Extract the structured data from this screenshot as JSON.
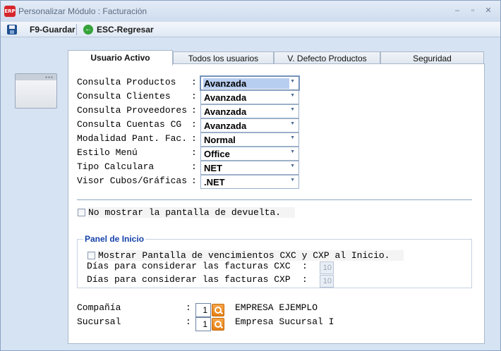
{
  "window": {
    "title": "Personalizar Módulo : Facturación",
    "app_icon_text": "ERP"
  },
  "toolbar": {
    "save_label": "F9-Guardar",
    "back_label": "ESC-Regresar"
  },
  "tabs": [
    {
      "label": "Usuario Activo",
      "active": true
    },
    {
      "label": "Todos los usuarios",
      "active": false
    },
    {
      "label": "V. Defecto Productos",
      "active": false
    },
    {
      "label": "Seguridad",
      "active": false
    }
  ],
  "settings": [
    {
      "label": "Consulta Productos",
      "value": "Avanzada"
    },
    {
      "label": "Consulta Clientes",
      "value": "Avanzada"
    },
    {
      "label": "Consulta Proveedores",
      "value": "Avanzada"
    },
    {
      "label": "Consulta Cuentas CG",
      "value": "Avanzada"
    },
    {
      "label": "Modalidad Pant. Fac.",
      "value": "Normal"
    },
    {
      "label": "Estilo Menú",
      "value": "Office"
    },
    {
      "label": "Tipo Calculara",
      "value": "NET"
    },
    {
      "label": "Visor Cubos/Gráficas",
      "value": ".NET"
    }
  ],
  "colon": ":",
  "no_devuelta_label": "No mostrar la pantalla de devuelta.",
  "panel_inicio": {
    "title": "Panel de Inicio",
    "show_vencimientos_label": "Mostrar Pantalla de vencimientos CXC y CXP al Inicio.",
    "dias_cxc_label": "Días para considerar las facturas CXC",
    "dias_cxc_value": "10",
    "dias_cxp_label": "Días para considerar las facturas CXP",
    "dias_cxp_value": "10"
  },
  "company": {
    "compania_label": "Compañía",
    "compania_code": "1",
    "compania_name": "EMPRESA EJEMPLO",
    "sucursal_label": "Sucursal",
    "sucursal_code": "1",
    "sucursal_name": "Empresa Sucursal I"
  }
}
